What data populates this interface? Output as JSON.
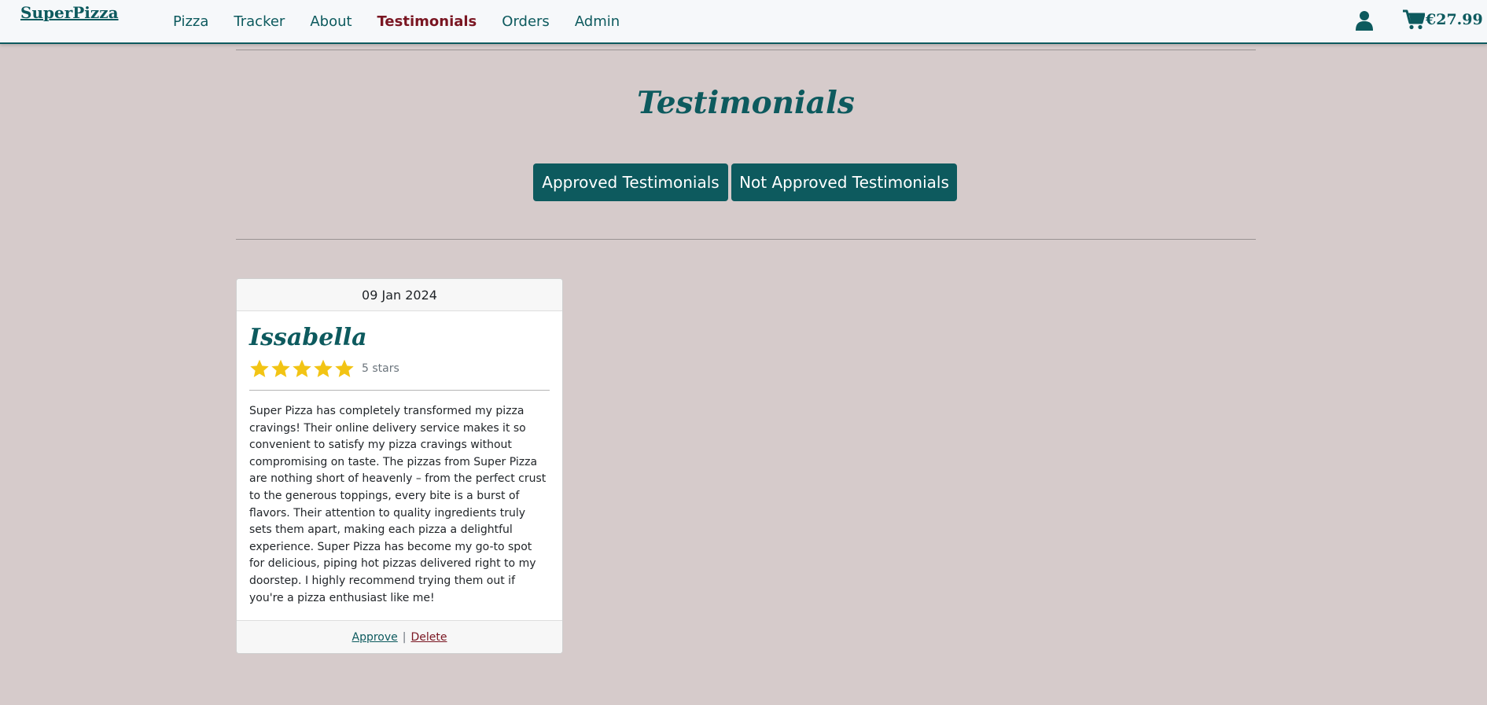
{
  "nav": {
    "brand": "SuperPizza",
    "links": [
      "Pizza",
      "Tracker",
      "About",
      "Testimonials",
      "Orders",
      "Admin"
    ],
    "active": "Testimonials",
    "cart_total": "€27.99",
    "account_icon": "user-icon",
    "cart_icon": "shopping-cart-icon"
  },
  "page": {
    "title": "Testimonials",
    "approved_button": "Approved Testimonials",
    "not_approved_button": "Not Approved Testimonials"
  },
  "testimonial": {
    "date": "09 Jan 2024",
    "author": "Issabella",
    "rating": 5,
    "rating_text": "5 stars",
    "text": "Super Pizza has completely transformed my pizza cravings! Their online delivery service makes it so convenient to satisfy my pizza cravings without compromising on taste. The pizzas from Super Pizza are nothing short of heavenly – from the perfect crust to the generous toppings, every bite is a burst of flavors. Their attention to quality ingredients truly sets them apart, making each pizza a delightful experience. Super Pizza has become my go-to spot for delicious, piping hot pizzas delivered right to my doorstep. I highly recommend trying them out if you're a pizza enthusiast like me!",
    "approve_label": "Approve",
    "separator": "|",
    "delete_label": "Delete"
  },
  "colors": {
    "primary": "#0d5a5e",
    "active_link": "#7a1622",
    "background": "#d6cbcb",
    "star": "#f2c414"
  }
}
